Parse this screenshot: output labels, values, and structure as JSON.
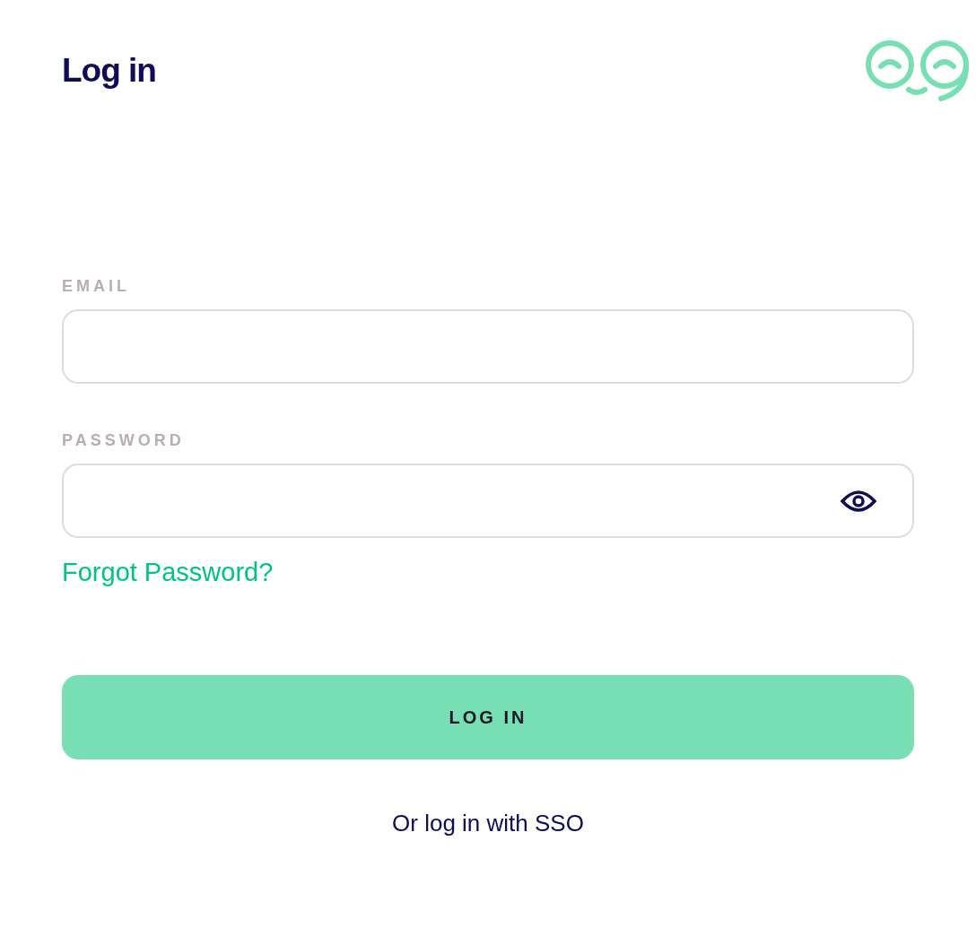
{
  "title": "Log in",
  "fields": [
    {
      "label": "EMAIL",
      "kind": "email"
    },
    {
      "label": "PASSWORD",
      "kind": "password"
    }
  ],
  "forgot_link": "Forgot Password?",
  "submit_button": "LOG IN",
  "sso_link": "Or log in with SSO"
}
